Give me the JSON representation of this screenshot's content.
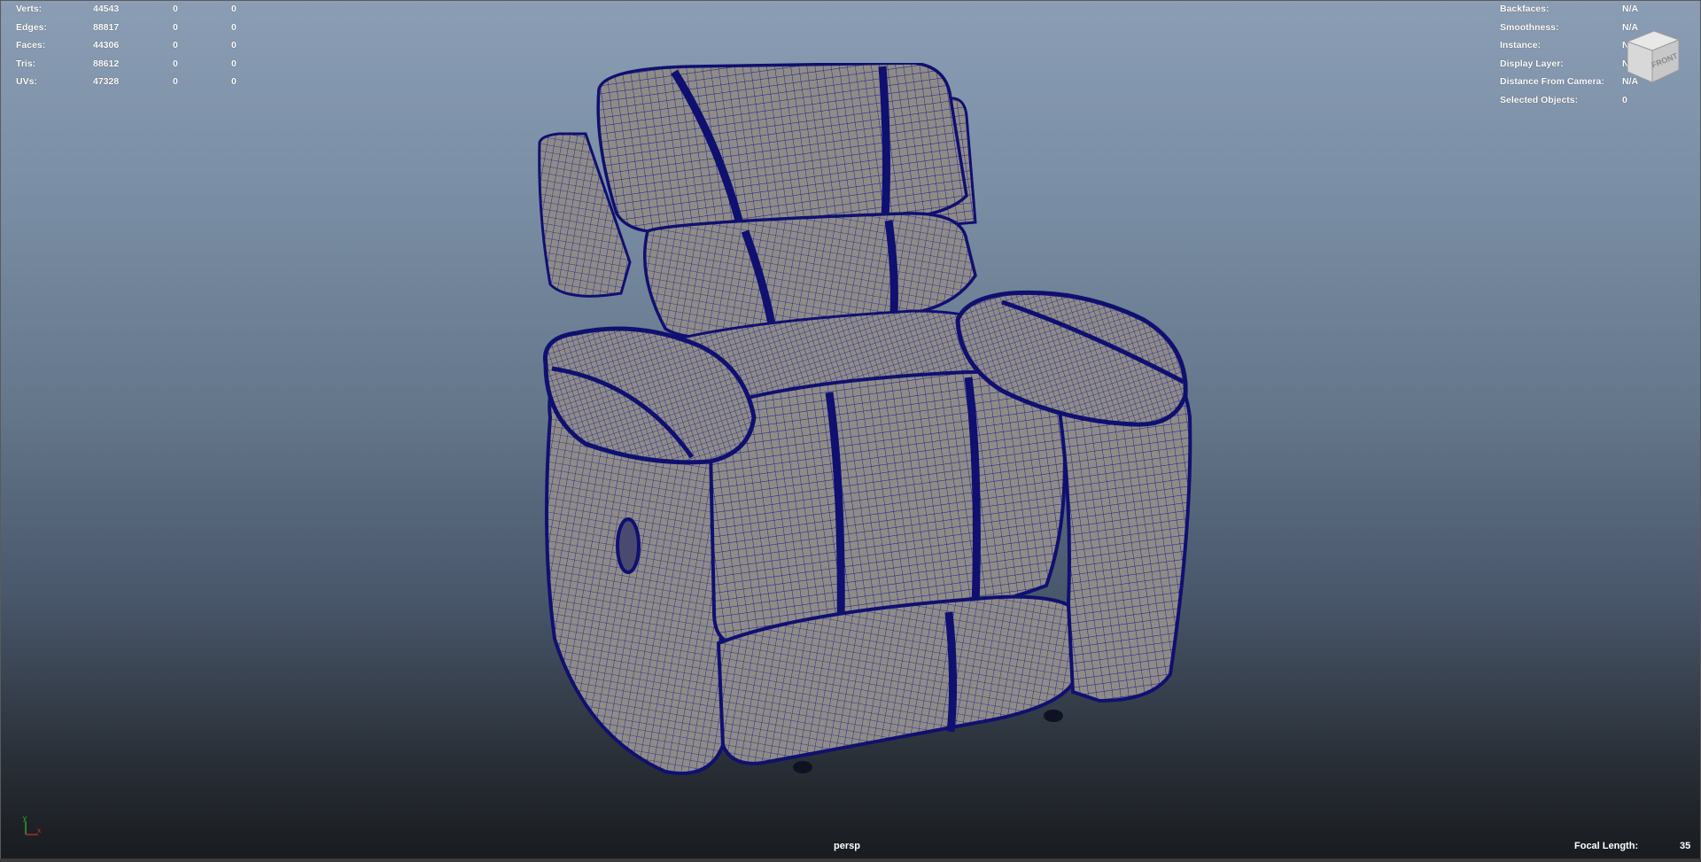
{
  "viewport": {
    "camera": "persp",
    "focal_length_label": "Focal Length:",
    "focal_length_value": "35",
    "viewcube_label": "FRONT",
    "axis": {
      "y": "y",
      "x": "x"
    }
  },
  "poly_count": [
    {
      "label": "Verts:",
      "total": "44543",
      "selected": "0",
      "component": "0"
    },
    {
      "label": "Edges:",
      "total": "88817",
      "selected": "0",
      "component": "0"
    },
    {
      "label": "Faces:",
      "total": "44306",
      "selected": "0",
      "component": "0"
    },
    {
      "label": "Tris:",
      "total": "88612",
      "selected": "0",
      "component": "0"
    },
    {
      "label": "UVs:",
      "total": "47328",
      "selected": "0",
      "component": "0"
    }
  ],
  "object_details": [
    {
      "label": "Backfaces:",
      "value": "N/A"
    },
    {
      "label": "Smoothness:",
      "value": "N/A"
    },
    {
      "label": "Instance:",
      "value": "N/A"
    },
    {
      "label": "Display Layer:",
      "value": "N/A"
    },
    {
      "label": "Distance From Camera:",
      "value": "N/A"
    },
    {
      "label": "Selected Objects:",
      "value": "0"
    }
  ],
  "colors": {
    "wireframe": "#1a1a8c",
    "mesh_fill": "#8f8c88",
    "hud_text": "#ffffff",
    "axis_x": "#d23030",
    "axis_y": "#30c030"
  }
}
